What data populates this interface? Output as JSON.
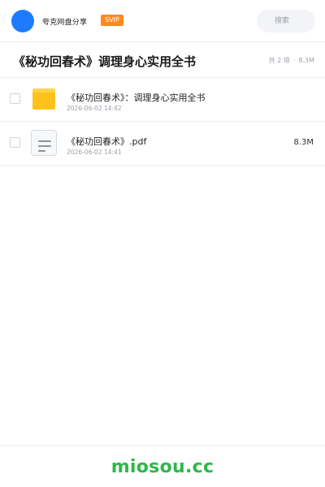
{
  "header": {
    "username": "夸克网盘分享",
    "badge": "SVIP",
    "search_placeholder": "搜索"
  },
  "folder": {
    "title": "《秘功回春术》调理身心实用全书",
    "count_text": "共 2 项",
    "total_size": "8.3M"
  },
  "files": [
    {
      "name": "《秘功回春术》：调理身心实用全书",
      "date": "2026-06-02 14:42",
      "size": "",
      "icon": "folder-icon"
    },
    {
      "name": "《秘功回春术》.pdf",
      "date": "2026-06-02 14:41",
      "size": "8.3M",
      "icon": "document-icon"
    }
  ],
  "footer": {
    "brand": "miosou.cc"
  },
  "colors": {
    "accent": "#1e7bff",
    "badge": "#ff8a1f",
    "folder": "#ffc21a",
    "brand": "#2db84a"
  }
}
